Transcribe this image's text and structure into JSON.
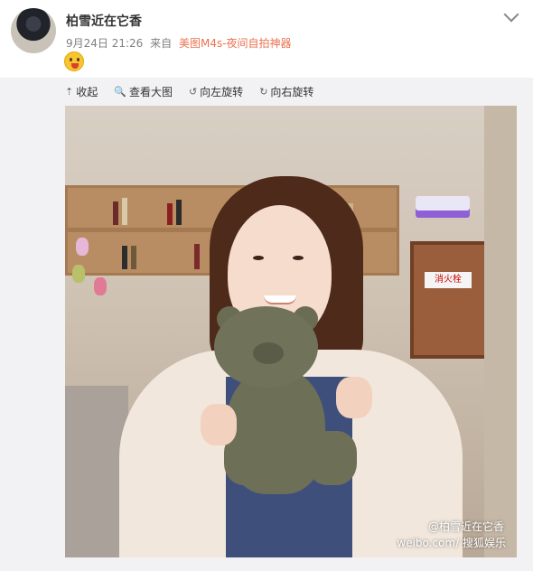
{
  "post": {
    "username": "柏雪近在它香",
    "date": "9月24日 21:26",
    "from_label": "来自",
    "source": "美图M4s-夜间自拍神器"
  },
  "toolbar": {
    "collapse_label": "收起",
    "view_large_label": "查看大图",
    "rotate_left_label": "向左旋转",
    "rotate_right_label": "向右旋转"
  },
  "photo": {
    "cabinet_label": "消火栓",
    "watermark_site": "weibo.com/",
    "watermark_user": "@柏雪近在它香",
    "watermark_brand": "搜狐娱乐"
  },
  "icons": [
    "avatar",
    "emoji-icon",
    "chevron-down-icon",
    "collapse-icon",
    "zoom-icon",
    "rotate-left-icon",
    "rotate-right-icon"
  ],
  "colors": {
    "source_link": "#eb7350",
    "meta": "#808080",
    "media_bg": "#f2f2f5"
  }
}
